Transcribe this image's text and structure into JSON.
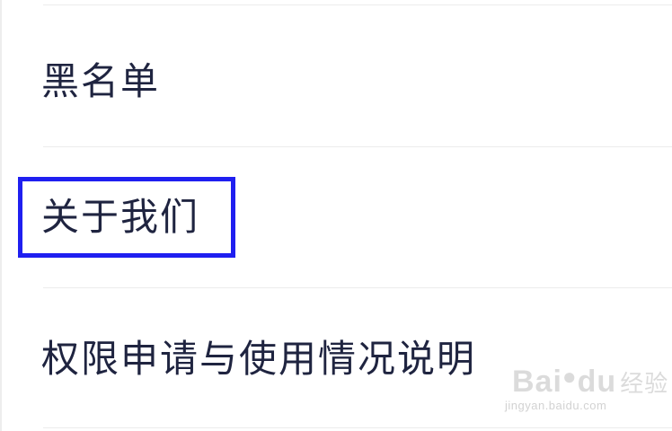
{
  "settings_list": {
    "items": [
      {
        "label": "黑名单"
      },
      {
        "label": "关于我们",
        "highlighted": true
      },
      {
        "label": "权限申请与使用情况说明"
      }
    ]
  },
  "highlight": {
    "target": "关于我们",
    "color": "#1f1ff0"
  },
  "watermark": {
    "logo_text": "Bai",
    "logo_suffix": "du",
    "logo_cn": "经验",
    "url": "jingyan.baidu.com"
  },
  "colors": {
    "text": "#1f2440",
    "divider": "#ececec",
    "background": "#ffffff"
  }
}
